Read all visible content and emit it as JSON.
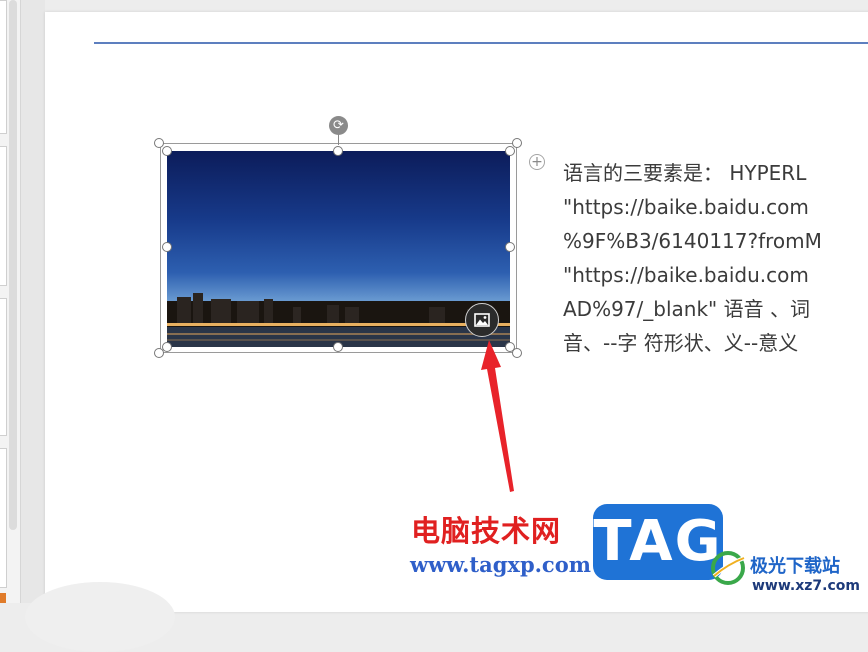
{
  "body_text": {
    "lines": [
      "语言的三要素是： HYPERL",
      "\"https://baike.baidu.com",
      "%9F%B3/6140117?fromM",
      "\"https://baike.baidu.com",
      "AD%97/_blank\" 语音 、词",
      "音、--字 符形状、义--意义"
    ]
  },
  "watermark": {
    "site_name_cn": "电脑技术网",
    "site_url": "www.tagxp.com",
    "tag_label": "TAG",
    "xz_name": "极光下载站",
    "xz_url": "www.xz7.com"
  },
  "icons": {
    "rotate": "rotate-icon",
    "image_tool": "image-icon",
    "add": "plus-icon"
  },
  "colors": {
    "title_line": "#5d7fbf",
    "arrow": "#e8232a",
    "watermark_red": "#e02020",
    "watermark_blue": "#2f5fc9",
    "tag_bg": "#1f73d6"
  }
}
